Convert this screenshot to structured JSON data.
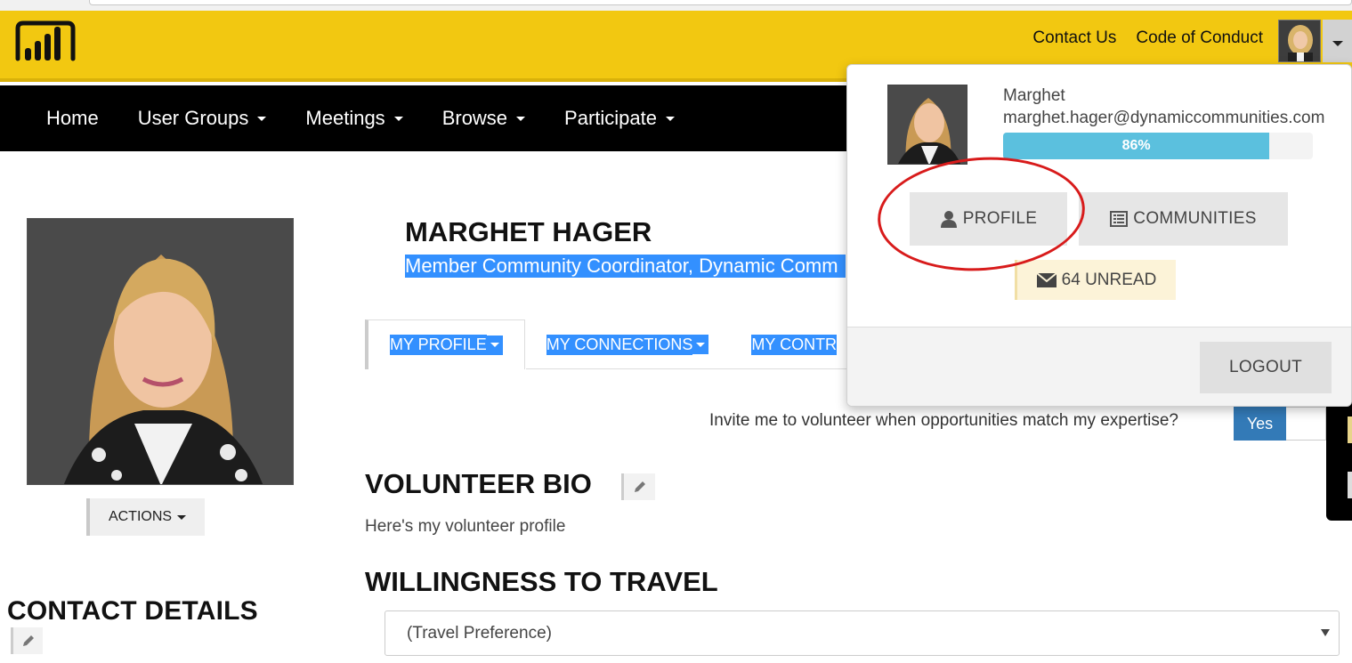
{
  "header": {
    "links": [
      "Contact Us",
      "Code of Conduct"
    ],
    "brand_color": "#f2c811"
  },
  "nav": {
    "items": [
      {
        "label": "Home",
        "has_dropdown": false
      },
      {
        "label": "User Groups",
        "has_dropdown": true
      },
      {
        "label": "Meetings",
        "has_dropdown": true
      },
      {
        "label": "Browse",
        "has_dropdown": true
      },
      {
        "label": "Participate",
        "has_dropdown": true
      }
    ]
  },
  "profile": {
    "name": "MARGHET HAGER",
    "title": "Member Community Coordinator, Dynamic Comm",
    "actions_label": "ACTIONS",
    "tabs": [
      "MY PROFILE",
      "MY CONNECTIONS",
      "MY CONTR"
    ],
    "invite_question": "Invite me to volunteer when opportunities match my expertise?",
    "invite_toggle": "Yes",
    "volunteer_bio_title": "VOLUNTEER BIO",
    "volunteer_bio_text": "Here's my volunteer profile",
    "travel_title": "WILLINGNESS TO TRAVEL",
    "travel_select_value": "(Travel Preference)",
    "contact_title": "CONTACT DETAILS"
  },
  "user_menu": {
    "first_name": "Marghet",
    "email": "marghet.hager@dynamiccommunities.com",
    "completion_percent": 86,
    "completion_label": "86%",
    "profile_button": "PROFILE",
    "communities_button": "COMMUNITIES",
    "unread_label": "64 UNREAD",
    "logout_button": "LOGOUT"
  }
}
